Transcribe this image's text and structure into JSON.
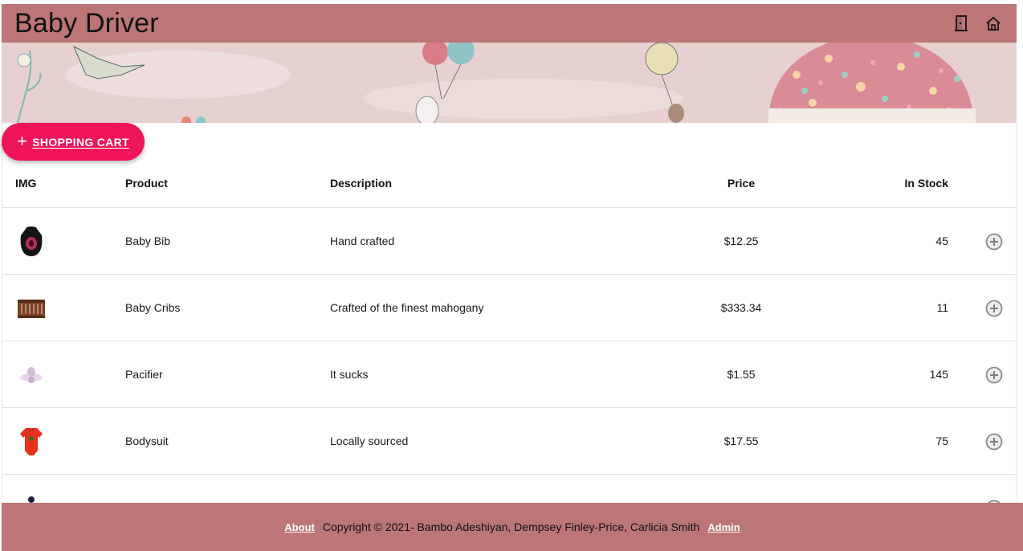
{
  "app": {
    "title": "Baby Driver"
  },
  "header": {
    "icons": [
      "door-icon",
      "home-icon"
    ]
  },
  "cart_button": {
    "label": "SHOPPING CART",
    "icon": "plus-icon"
  },
  "table": {
    "headers": {
      "img": "IMG",
      "product": "Product",
      "description": "Description",
      "price": "Price",
      "stock": "In Stock"
    },
    "rows": [
      {
        "product": "Baby Bib",
        "description": "Hand crafted",
        "price": "$12.25",
        "stock": "45",
        "image": "bib-image"
      },
      {
        "product": "Baby Cribs",
        "description": "Crafted of the finest mahogany",
        "price": "$333.34",
        "stock": "11",
        "image": "crib-image"
      },
      {
        "product": "Pacifier",
        "description": "It sucks",
        "price": "$1.55",
        "stock": "145",
        "image": "pacifier-image"
      },
      {
        "product": "Bodysuit",
        "description": "Locally sourced",
        "price": "$17.55",
        "stock": "75",
        "image": "bodysuit-image"
      }
    ]
  },
  "footer": {
    "about_link": "About",
    "copyright": "Copyright © 2021- Bambo Adeshiyan, Dempsey Finley-Price, Carlicia Smith",
    "admin_link": "Admin"
  },
  "colors": {
    "brand": "#bb7675",
    "accent": "#f0145b",
    "banner": "#e6d1d0"
  }
}
